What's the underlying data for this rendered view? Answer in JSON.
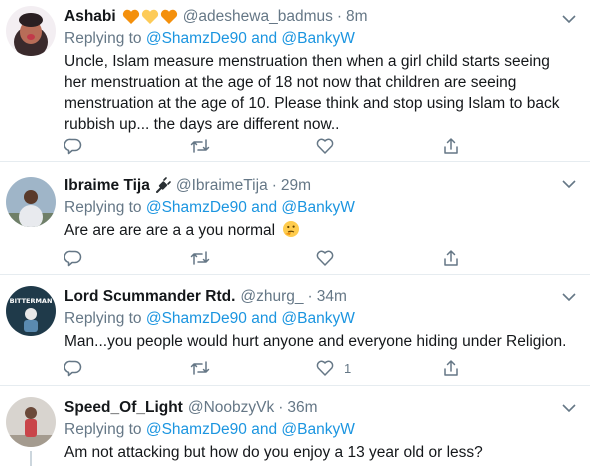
{
  "tweets": [
    {
      "name": "Ashabi",
      "handle": "@adeshewa_badmus",
      "separator": "·",
      "time": "8m",
      "reply_prefix": "Replying to",
      "reply_user1": "@ShamzDe90",
      "reply_and": "and",
      "reply_user2": "@BankyW",
      "text": "Uncle,  Islam measure menstruation then when a girl child starts seeing her menstruation at the age of 18 not now that children are seeing menstruation at the age of 10. Please think and stop using Islam to back rubbish up... the days are different now..",
      "like_count": "",
      "badge_icons": [
        "orange-heart-icon",
        "yellow-heart-icon",
        "orange-heart-icon"
      ]
    },
    {
      "name": "Ibraime Tija",
      "handle": "@IbraimeTija",
      "separator": "·",
      "time": "29m",
      "reply_prefix": "Replying to",
      "reply_user1": "@ShamzDe90",
      "reply_and": "and",
      "reply_user2": "@BankyW",
      "text": "Are are are are a a you normal",
      "like_count": "",
      "badge_icons": [
        "plug-icon"
      ],
      "text_emoji": "thinking-face-icon"
    },
    {
      "name": "Lord Scummander Rtd.",
      "handle": "@zhurg_",
      "separator": "·",
      "time": "34m",
      "reply_prefix": "Replying to",
      "reply_user1": "@ShamzDe90",
      "reply_and": "and",
      "reply_user2": "@BankyW",
      "text": "Man...you people would hurt anyone and everyone hiding under Religion.",
      "like_count": "1",
      "avatar_text": "BITTERMAN"
    },
    {
      "name": "Speed_Of_Light",
      "handle": "@NoobzyVk",
      "separator": "·",
      "time": "36m",
      "reply_prefix": "Replying to",
      "reply_user1": "@ShamzDe90",
      "reply_and": "and",
      "reply_user2": "@BankyW",
      "text": "Am not attacking but how do you enjoy a 13 year old or less?"
    }
  ],
  "colors": {
    "link": "#1b95e0",
    "muted": "#657786",
    "text": "#14171a",
    "divider": "#e6ecf0"
  }
}
